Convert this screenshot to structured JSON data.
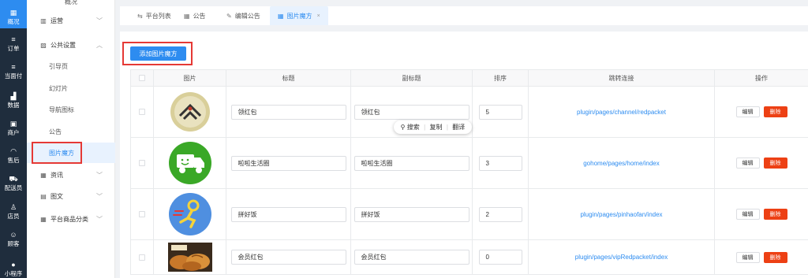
{
  "rail": {
    "items": [
      {
        "icon": "▦",
        "label": "概况"
      },
      {
        "icon": "≡",
        "label": "订单"
      },
      {
        "icon": "≡",
        "label": "当面付"
      },
      {
        "icon": "▟",
        "label": "数据"
      },
      {
        "icon": "▣",
        "label": "商户"
      },
      {
        "icon": "◠",
        "label": "售后"
      },
      {
        "icon": "⛟",
        "label": "配送员"
      },
      {
        "icon": "♙",
        "label": "店员"
      },
      {
        "icon": "☺",
        "label": "顾客"
      },
      {
        "icon": "●",
        "label": "小程序"
      }
    ]
  },
  "menu": {
    "title": "概况",
    "groups": [
      {
        "icon": "▥",
        "label": "运营",
        "chevron": "﹀"
      },
      {
        "icon": "▨",
        "label": "公共设置",
        "chevron": "︿"
      }
    ],
    "subs": [
      "引导页",
      "幻灯片",
      "导航图标",
      "公告",
      "图片魔方"
    ],
    "groups2": [
      {
        "icon": "▦",
        "label": "资讯",
        "chevron": "﹀"
      },
      {
        "icon": "▤",
        "label": "图文",
        "chevron": "﹀"
      },
      {
        "icon": "▦",
        "label": "平台商品分类",
        "chevron": "﹀"
      }
    ]
  },
  "tabs": [
    {
      "icon": "⇆",
      "label": "平台列表"
    },
    {
      "icon": "▦",
      "label": "公告"
    },
    {
      "icon": "✎",
      "label": "编辑公告"
    },
    {
      "icon": "▦",
      "label": "图片魔方",
      "close": "×"
    }
  ],
  "add_button": "添加图片魔方",
  "columns": [
    "",
    "图片",
    "标题",
    "副标题",
    "排序",
    "跳转连接",
    "操作"
  ],
  "rows": [
    {
      "title": "领红包",
      "subtitle": "领红包",
      "sort": "5",
      "link": "plugin/pages/channel/redpacket",
      "image": "hand-heart-logo"
    },
    {
      "title": "啦啦生活圈",
      "subtitle": "啦啦生活圈",
      "sort": "3",
      "link": "gohome/pages/home/index",
      "image": "delivery-truck-logo"
    },
    {
      "title": "拼好饭",
      "subtitle": "拼好饭",
      "sort": "2",
      "link": "plugin/pages/pinhaofan/index",
      "image": "running-man-logo"
    },
    {
      "title": "会员红包",
      "subtitle": "会员红包",
      "sort": "0",
      "link": "plugin/pages/vipRedpacket/index",
      "image": "bread-photo"
    }
  ],
  "actions": {
    "edit": "编辑",
    "delete": "删除"
  },
  "popup": {
    "search": "搜索",
    "copy": "复制",
    "translate": "翻译"
  },
  "colors": {
    "primary": "#2d8cf0",
    "danger": "#ed4014",
    "rail": "#1f2d3d",
    "highlight_box": "#e53935"
  }
}
